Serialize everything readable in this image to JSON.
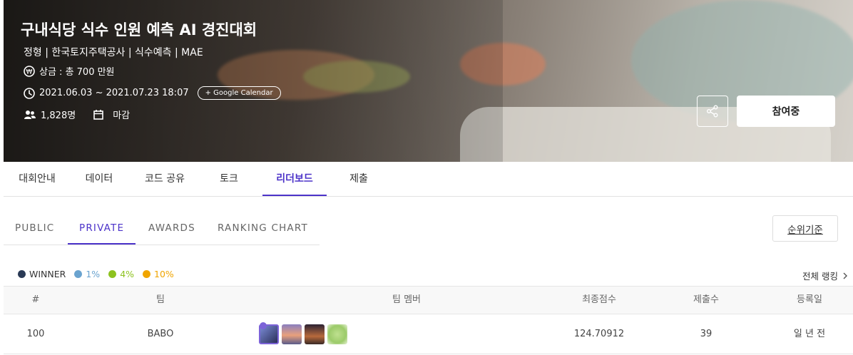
{
  "competition": {
    "title": "구내식당 식수 인원 예측 AI 경진대회",
    "meta": "정형 | 한국토지주택공사 | 식수예측 | MAE",
    "prize": "상금 : 총 700 만원",
    "period": "2021.06.03 ~ 2021.07.23 18:07",
    "calendar_btn": "+ Google Calendar",
    "participants": "1,828명",
    "status": "마감",
    "join_btn": "참여중"
  },
  "main_tabs": [
    "대회안내",
    "데이터",
    "코드 공유",
    "토크",
    "리더보드",
    "제출"
  ],
  "main_tab_active": "리더보드",
  "sub_tabs": [
    "PUBLIC",
    "PRIVATE",
    "AWARDS",
    "RANKING CHART"
  ],
  "sub_tab_active": "PRIVATE",
  "rank_basis_btn": "순위기준",
  "legend": [
    {
      "label": "WINNER",
      "color": "#2a3a55"
    },
    {
      "label": "1%",
      "color": "#6aa3cf"
    },
    {
      "label": "4%",
      "color": "#8dc21f"
    },
    {
      "label": "10%",
      "color": "#f0a500"
    }
  ],
  "full_ranking_link": "전체 랭킹",
  "table": {
    "headers": [
      "#",
      "팀",
      "팀 멤버",
      "최종점수",
      "제출수",
      "등록일"
    ],
    "rows": [
      {
        "rank": "100",
        "team": "BABO",
        "score": "124.70912",
        "submissions": "39",
        "registered": "일 년 전"
      }
    ]
  },
  "icons": {
    "prize": "won-icon",
    "date": "clock-icon",
    "people": "people-icon",
    "deadline": "calendar-icon",
    "share": "share-icon",
    "more": "chevron-right-icon"
  },
  "colors": {
    "accent": "#4c33c9"
  }
}
